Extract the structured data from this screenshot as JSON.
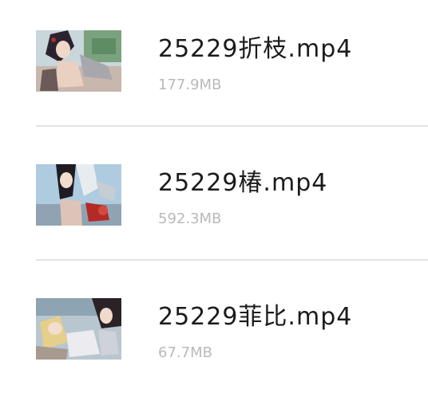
{
  "files": [
    {
      "name": "25229折枝.mp4",
      "size": "177.9MB",
      "thumbnail": "video-thumbnail"
    },
    {
      "name": "25229椿.mp4",
      "size": "592.3MB",
      "thumbnail": "video-thumbnail"
    },
    {
      "name": "25229菲比.mp4",
      "size": "67.7MB",
      "thumbnail": "video-thumbnail"
    }
  ],
  "colors": {
    "name_text": "#1b1b1b",
    "size_text": "#b9b9b9",
    "divider": "#e3e3e3",
    "background": "#ffffff"
  }
}
